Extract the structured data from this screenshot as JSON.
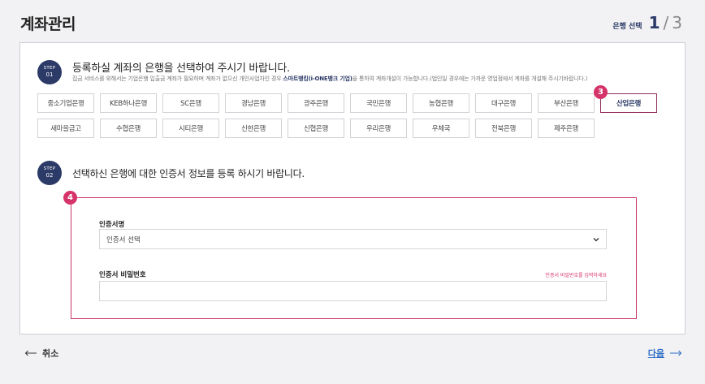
{
  "header": {
    "title": "계좌관리",
    "step_label": "은행 선택",
    "step_current": "1",
    "step_sep": "/",
    "step_total": "3"
  },
  "step1": {
    "badge_label": "STEP",
    "badge_num": "01",
    "heading": "등록하실 계좌의 은행을 선택하여 주시기 바랍니다.",
    "note_before": "집금 서비스를 위해서는 기업은행 입출금 계좌가 필요하며 계좌가 없으신 개인사업자인 경우 ",
    "note_highlight": "스마트뱅킹(i-ONE뱅크 기업)",
    "note_after": "을 통하여 계좌개설이 가능합니다.(법인일 경우에는 가까운 영업점에서 계좌를 개설해 주시기바랍니다.)",
    "marker": "3",
    "banks_row1": [
      "중소기업은행",
      "KEB하나은행",
      "SC은행",
      "경남은행",
      "광주은행",
      "국민은행",
      "농협은행",
      "대구은행",
      "부산은행",
      "산업은행"
    ],
    "banks_row2": [
      "새마을금고",
      "수협은행",
      "시티은행",
      "신한은행",
      "신협은행",
      "우리은행",
      "우체국",
      "전북은행",
      "제주은행"
    ],
    "selected_bank": "산업은행"
  },
  "step2": {
    "badge_label": "STEP",
    "badge_num": "02",
    "heading": "선택하신 은행에 대한 인증서 정보를 등록 하시기 바랍니다.",
    "marker": "4",
    "cert_name_label": "인증서명",
    "cert_select_value": "인증서 선택",
    "cert_pw_label": "인증서 비밀번호",
    "cert_pw_error": "인증서 비밀번호를 입력하세요",
    "cert_pw_value": ""
  },
  "footer": {
    "cancel_label": "취소",
    "next_label": "다음"
  },
  "colors": {
    "navy": "#2b3a67",
    "accent_pink": "#d5346b",
    "selected_border": "#8e2a58",
    "link_blue": "#2b6cc4"
  }
}
